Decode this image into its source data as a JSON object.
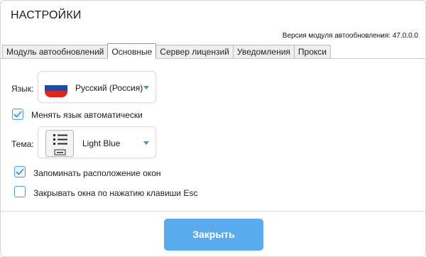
{
  "window": {
    "title": "НАСТРОЙКИ",
    "version_text": "Версия модуля автообновления: 47.0.0.0"
  },
  "tabs": [
    {
      "label": "Модуль автообновлений",
      "active": false
    },
    {
      "label": "Основные",
      "active": true
    },
    {
      "label": "Сервер лицензий",
      "active": false
    },
    {
      "label": "Уведомления",
      "active": false
    },
    {
      "label": "Прокси",
      "active": false
    }
  ],
  "language": {
    "label": "Язык:",
    "value": "Русский (Россия)",
    "flag_colors": [
      "#ffffff",
      "#1f4aa8",
      "#e1261f"
    ]
  },
  "auto_language": {
    "label": "Менять язык автоматически",
    "checked": true
  },
  "theme": {
    "label": "Тема:",
    "value": "Light Blue"
  },
  "remember_windows": {
    "label": "Запоминать расположение окон",
    "checked": true
  },
  "close_on_esc": {
    "label": "Закрывать окна по нажатию клавиши Esc",
    "checked": false
  },
  "footer": {
    "close_label": "Закрыть"
  },
  "colors": {
    "accent": "#5aaaee",
    "checkbox_border": "#4b9ae0",
    "caret": "#3c8fd6"
  }
}
